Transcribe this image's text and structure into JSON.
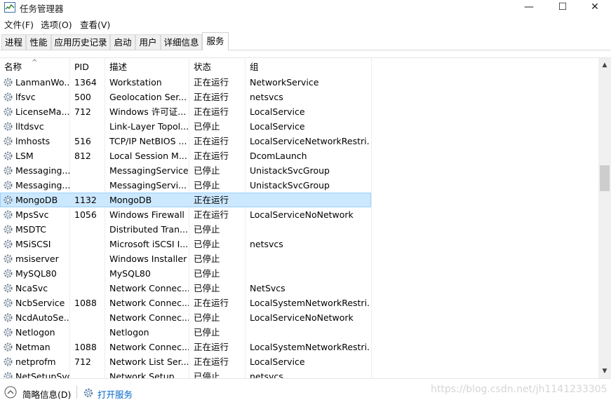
{
  "window": {
    "title": "任务管理器",
    "minimize": "—",
    "maximize": "☐",
    "close": "✕"
  },
  "menu": [
    {
      "label": "文件(F)"
    },
    {
      "label": "选项(O)"
    },
    {
      "label": "查看(V)"
    }
  ],
  "tabs": [
    {
      "label": "进程"
    },
    {
      "label": "性能"
    },
    {
      "label": "应用历史记录"
    },
    {
      "label": "启动"
    },
    {
      "label": "用户"
    },
    {
      "label": "详细信息"
    },
    {
      "label": "服务",
      "active": true
    }
  ],
  "columns": {
    "name": "名称",
    "pid": "PID",
    "desc": "描述",
    "status": "状态",
    "group": "组"
  },
  "rows": [
    {
      "name": "LanmanWo...",
      "pid": "1364",
      "desc": "Workstation",
      "status": "正在运行",
      "group": "NetworkService"
    },
    {
      "name": "lfsvc",
      "pid": "500",
      "desc": "Geolocation Ser...",
      "status": "正在运行",
      "group": "netsvcs"
    },
    {
      "name": "LicenseMa...",
      "pid": "712",
      "desc": "Windows 许可证...",
      "status": "正在运行",
      "group": "LocalService"
    },
    {
      "name": "lltdsvc",
      "pid": "",
      "desc": "Link-Layer Topol...",
      "status": "已停止",
      "group": "LocalService"
    },
    {
      "name": "lmhosts",
      "pid": "516",
      "desc": "TCP/IP NetBIOS ...",
      "status": "正在运行",
      "group": "LocalServiceNetworkRestri..."
    },
    {
      "name": "LSM",
      "pid": "812",
      "desc": "Local Session M...",
      "status": "正在运行",
      "group": "DcomLaunch"
    },
    {
      "name": "Messaging...",
      "pid": "",
      "desc": "MessagingService",
      "status": "已停止",
      "group": "UnistackSvcGroup"
    },
    {
      "name": "Messaging...",
      "pid": "",
      "desc": "MessagingServi...",
      "status": "已停止",
      "group": "UnistackSvcGroup"
    },
    {
      "name": "MongoDB",
      "pid": "1132",
      "desc": "MongoDB",
      "status": "正在运行",
      "group": "",
      "selected": true
    },
    {
      "name": "MpsSvc",
      "pid": "1056",
      "desc": "Windows Firewall",
      "status": "正在运行",
      "group": "LocalServiceNoNetwork"
    },
    {
      "name": "MSDTC",
      "pid": "",
      "desc": "Distributed Tran...",
      "status": "已停止",
      "group": ""
    },
    {
      "name": "MSiSCSI",
      "pid": "",
      "desc": "Microsoft iSCSI I...",
      "status": "已停止",
      "group": "netsvcs"
    },
    {
      "name": "msiserver",
      "pid": "",
      "desc": "Windows Installer",
      "status": "已停止",
      "group": ""
    },
    {
      "name": "MySQL80",
      "pid": "",
      "desc": "MySQL80",
      "status": "已停止",
      "group": ""
    },
    {
      "name": "NcaSvc",
      "pid": "",
      "desc": "Network Connec...",
      "status": "已停止",
      "group": "NetSvcs"
    },
    {
      "name": "NcbService",
      "pid": "1088",
      "desc": "Network Connec...",
      "status": "正在运行",
      "group": "LocalSystemNetworkRestri..."
    },
    {
      "name": "NcdAutoSe...",
      "pid": "",
      "desc": "Network Connec...",
      "status": "已停止",
      "group": "LocalServiceNoNetwork"
    },
    {
      "name": "Netlogon",
      "pid": "",
      "desc": "Netlogon",
      "status": "已停止",
      "group": ""
    },
    {
      "name": "Netman",
      "pid": "1088",
      "desc": "Network Connec...",
      "status": "正在运行",
      "group": "LocalSystemNetworkRestri..."
    },
    {
      "name": "netprofm",
      "pid": "712",
      "desc": "Network List Ser...",
      "status": "正在运行",
      "group": "LocalService"
    },
    {
      "name": "NetSetupSvc",
      "pid": "",
      "desc": "Network Setup ...",
      "status": "已停止",
      "group": "netsvcs"
    }
  ],
  "footer": {
    "fewer_details": "简略信息(D)",
    "open_services": "打开服务",
    "watermark": "https://blog.csdn.net/jh1141233305"
  }
}
